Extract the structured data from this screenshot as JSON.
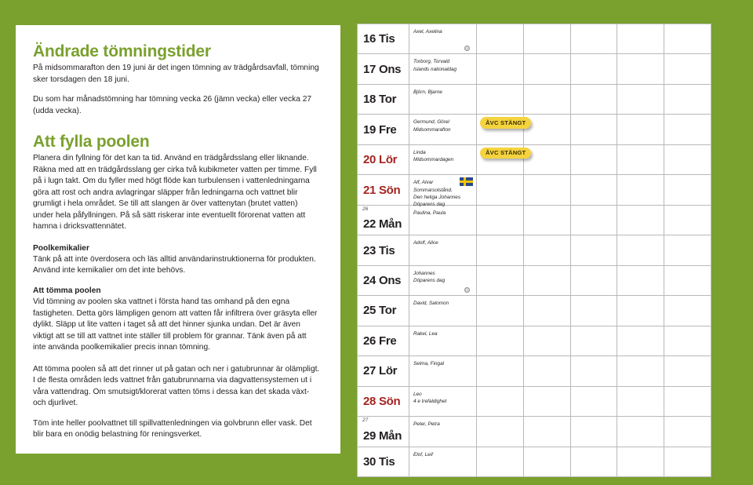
{
  "theme": {
    "background_green": "#7aa02e",
    "heading_green": "#7aa02e",
    "weekend_red": "#a32421",
    "badge_yellow": "#f5d33f",
    "text_dark": "#231f20"
  },
  "info_panel": {
    "sections": [
      {
        "heading": "Ändrade tömningstider",
        "paragraphs": [
          "På midsommarafton den 19 juni är det ingen tömning av trädgårdsavfall, tömning sker torsdagen den 18 juni.",
          "Du som har månadstömning har tömning vecka 26 (jämn vecka) eller vecka 27 (udda vecka)."
        ]
      },
      {
        "heading": "Att fylla poolen",
        "paragraphs": [
          "Planera din fyllning för det kan ta tid. Använd en trädgårdsslang eller liknande. Räkna med att en trädgårdsslang ger cirka två kubikmeter vatten per timme. Fyll på i lugn takt. Om du fyller med högt flöde kan turbulensen i vattenledningarna göra att rost och andra avlagringar släpper från ledningarna och vattnet blir grumligt i hela området. Se till att slangen är över vattenytan (brutet vatten) under hela påfyllningen. På så sätt riskerar inte eventuellt förorenat vatten att hamna i dricksvattennätet."
        ]
      }
    ],
    "subsections": [
      {
        "subhead": "Poolkemikalier",
        "body": "Tänk på att inte överdosera och läs alltid användarinstruktionerna för produkten. Använd inte kemikalier om det inte behövs."
      },
      {
        "subhead": "Att tömma poolen",
        "body": "Vid tömning av poolen ska vattnet i första hand tas omhand på den egna fastigheten. Detta görs lämpligen genom att vatten får infiltrera över gräsyta eller dylikt. Släpp ut lite vatten i taget så att det hinner sjunka undan. Det är även viktigt att se till att vattnet inte ställer till problem för grannar. Tänk även på att inte använda poolkemikalier precis innan tömning."
      }
    ],
    "closing_paragraphs": [
      "Att tömma poolen så att det rinner ut på gatan och ner i gatubrunnar är olämpligt. I de flesta områden leds vattnet från gatubrunnarna via dagvattensystemen ut i våra vattendrag. Om smutsigt/klorerat vatten töms i dessa kan det skada växt- och djurlivet.",
      "Töm inte heller poolvattnet till spillvattenledningen via golvbrunn eller vask. Det blir bara en onödig belastning för reningsverket."
    ]
  },
  "calendar": {
    "badge_label": "ÅVC STÄNGT",
    "rows": [
      {
        "day": "16 Tis",
        "weekend": false,
        "week": "",
        "names": [
          "Axel, Axelina"
        ],
        "moon": true,
        "flag": false,
        "badge": false
      },
      {
        "day": "17 Ons",
        "weekend": false,
        "week": "",
        "names": [
          "Torborg, Torvald",
          "Islands nationaldag"
        ],
        "moon": false,
        "flag": false,
        "badge": false
      },
      {
        "day": "18 Tor",
        "weekend": false,
        "week": "",
        "names": [
          "Björn, Bjarne"
        ],
        "moon": false,
        "flag": false,
        "badge": false
      },
      {
        "day": "19 Fre",
        "weekend": false,
        "week": "",
        "names": [
          "Germund, Görel",
          "Midsommarafton"
        ],
        "moon": false,
        "flag": false,
        "badge": true
      },
      {
        "day": "20 Lör",
        "weekend": true,
        "week": "",
        "names": [
          "Linda",
          "Midsommardagen"
        ],
        "moon": false,
        "flag": false,
        "badge": true
      },
      {
        "day": "21 Sön",
        "weekend": true,
        "week": "",
        "names": [
          "Alf, Alvar",
          "Sommarsolstånd,",
          "Den heliga Johannes",
          "Döparens dag"
        ],
        "moon": false,
        "flag": true,
        "badge": false
      },
      {
        "day": "22 Mån",
        "weekend": false,
        "week": "26",
        "names": [
          "Paulina, Paula"
        ],
        "moon": false,
        "flag": false,
        "badge": false
      },
      {
        "day": "23 Tis",
        "weekend": false,
        "week": "",
        "names": [
          "Adolf, Alice"
        ],
        "moon": false,
        "flag": false,
        "badge": false
      },
      {
        "day": "24 Ons",
        "weekend": false,
        "week": "",
        "names": [
          "Johannes",
          "Döparens dag"
        ],
        "moon": true,
        "flag": false,
        "badge": false
      },
      {
        "day": "25 Tor",
        "weekend": false,
        "week": "",
        "names": [
          "David, Salomon"
        ],
        "moon": false,
        "flag": false,
        "badge": false
      },
      {
        "day": "26 Fre",
        "weekend": false,
        "week": "",
        "names": [
          "Rakel, Lea"
        ],
        "moon": false,
        "flag": false,
        "badge": false
      },
      {
        "day": "27 Lör",
        "weekend": false,
        "week": "",
        "names": [
          "Selma, Fingal"
        ],
        "moon": false,
        "flag": false,
        "badge": false
      },
      {
        "day": "28 Sön",
        "weekend": true,
        "week": "",
        "names": [
          "Leo",
          "4 e trefaldighet"
        ],
        "moon": false,
        "flag": false,
        "badge": false
      },
      {
        "day": "29 Mån",
        "weekend": false,
        "week": "27",
        "names": [
          "Peter, Petra"
        ],
        "moon": false,
        "flag": false,
        "badge": false
      },
      {
        "day": "30 Tis",
        "weekend": false,
        "week": "",
        "names": [
          "Elof, Leif"
        ],
        "moon": false,
        "flag": false,
        "badge": false
      }
    ],
    "empty_column_count": 5
  }
}
